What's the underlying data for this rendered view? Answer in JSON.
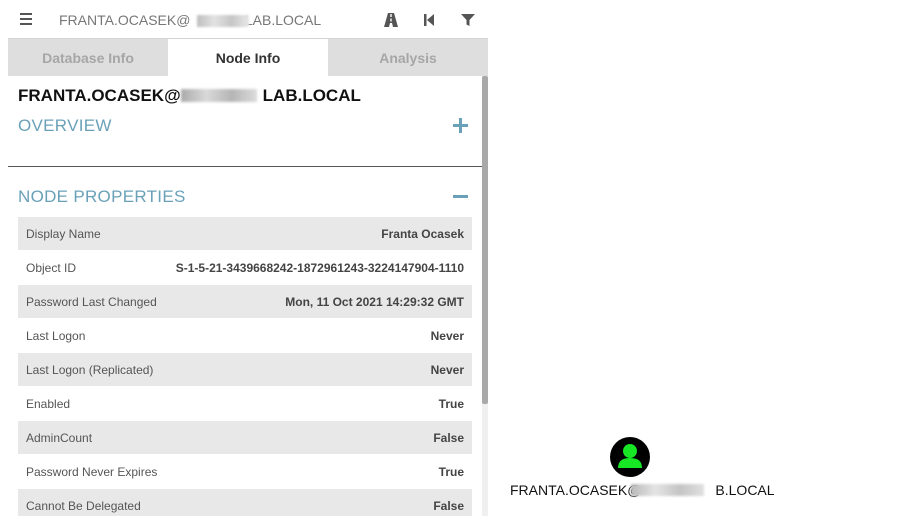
{
  "search": {
    "value": "FRANTA.OCASEK@",
    "value_suffix": "LAB.LOCAL"
  },
  "toolbar": {
    "menu_icon": "hamburger-menu-icon",
    "pathfinding_icon": "road-icon",
    "back_icon": "step-back-icon",
    "filter_icon": "filter-icon"
  },
  "tabs": [
    {
      "label": "Database Info",
      "active": false
    },
    {
      "label": "Node Info",
      "active": true
    },
    {
      "label": "Analysis",
      "active": false
    }
  ],
  "node": {
    "title_prefix": "FRANTA.OCASEK@",
    "title_suffix": "LAB.LOCAL"
  },
  "sections": {
    "overview": {
      "label": "OVERVIEW",
      "toggle": "+"
    },
    "properties": {
      "label": "NODE PROPERTIES",
      "toggle": "−"
    }
  },
  "properties": [
    {
      "key": "Display Name",
      "value": "Franta Ocasek"
    },
    {
      "key": "Object ID",
      "value": "S-1-5-21-3439668242-1872961243-3224147904-1110"
    },
    {
      "key": "Password Last Changed",
      "value": "Mon, 11 Oct 2021 14:29:32 GMT"
    },
    {
      "key": "Last Logon",
      "value": "Never"
    },
    {
      "key": "Last Logon (Replicated)",
      "value": "Never"
    },
    {
      "key": "Enabled",
      "value": "True"
    },
    {
      "key": "AdminCount",
      "value": "False"
    },
    {
      "key": "Password Never Expires",
      "value": "True"
    },
    {
      "key": "Cannot Be Delegated",
      "value": "False"
    }
  ],
  "graph_node": {
    "label_prefix": "FRANTA.OCASEK@",
    "label_suffix": "B.LOCAL",
    "icon": "user-icon",
    "icon_color": "#17e625"
  },
  "colors": {
    "section_heading": "#6aa1b8",
    "tab_inactive": "#dedede"
  }
}
